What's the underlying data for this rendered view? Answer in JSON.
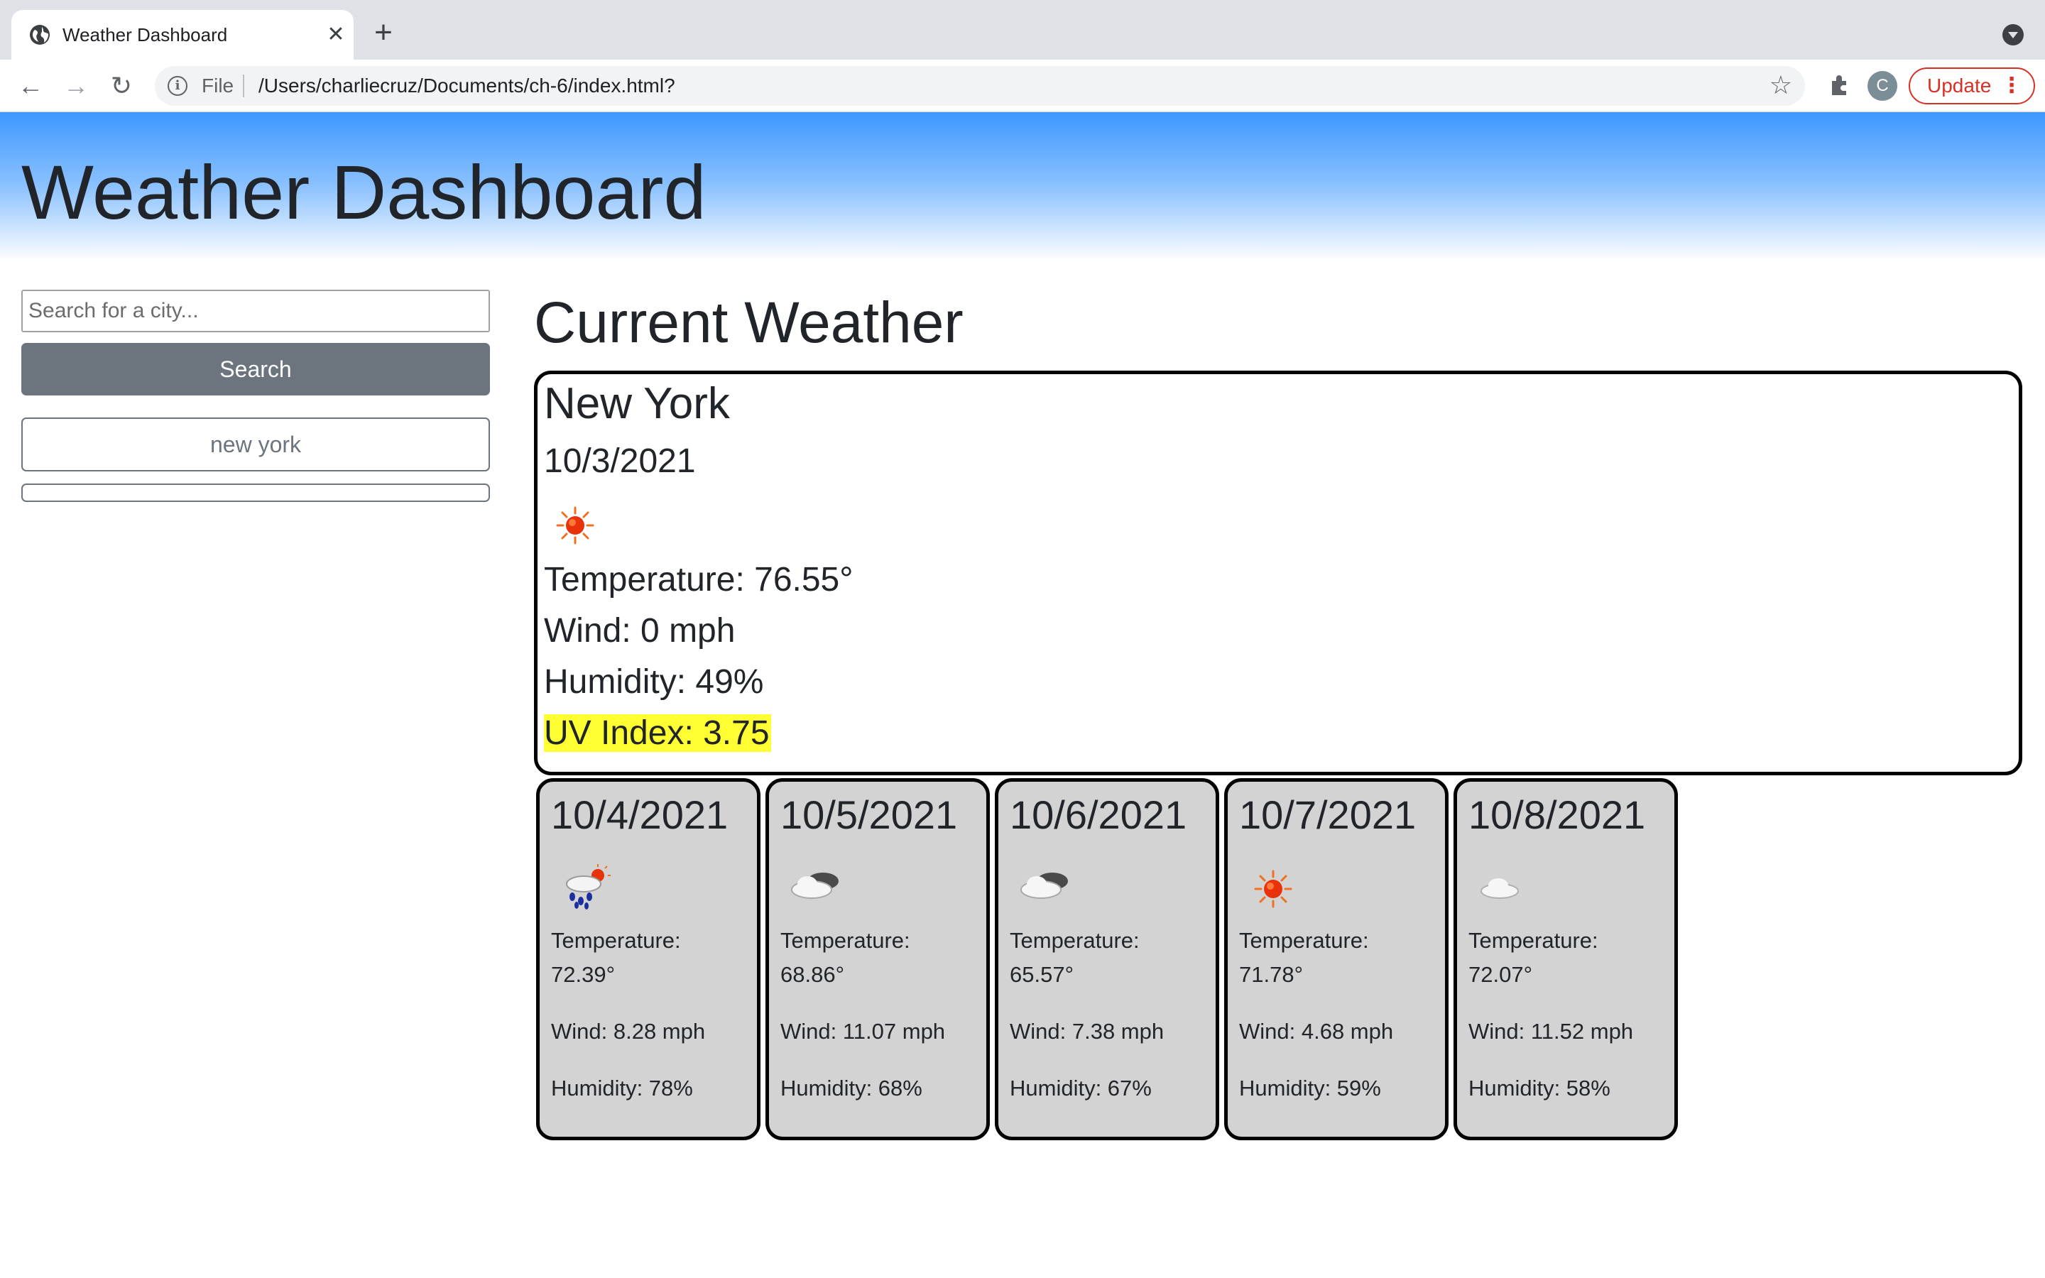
{
  "browser": {
    "tab_title": "Weather Dashboard",
    "new_tab": "+",
    "url_scheme": "File",
    "url": "/Users/charliecruz/Documents/ch-6/index.html?",
    "avatar_initial": "C",
    "update_label": "Update",
    "menu_dots": "⋮"
  },
  "header": {
    "title": "Weather Dashboard"
  },
  "sidebar": {
    "search_placeholder": "Search for a city...",
    "search_value": "",
    "search_button": "Search",
    "history": [
      "new york",
      ""
    ]
  },
  "current": {
    "section_title": "Current Weather",
    "city": "New York",
    "date": "10/3/2021",
    "icon": "sun-icon",
    "temperature": "Temperature: 76.55°",
    "wind": "Wind: 0 mph",
    "humidity": "Humidity: 49%",
    "uv": "UV Index: 3.75",
    "uv_color": "#ffff33"
  },
  "forecast": [
    {
      "date": "10/4/2021",
      "icon": "rain-sun-icon",
      "temp_label": "Temperature:",
      "temp_value": "72.39°",
      "wind": "Wind: 8.28 mph",
      "humidity": "Humidity: 78%"
    },
    {
      "date": "10/5/2021",
      "icon": "cloudy-icon",
      "temp_label": "Temperature:",
      "temp_value": "68.86°",
      "wind": "Wind: 11.07 mph",
      "humidity": "Humidity: 68%"
    },
    {
      "date": "10/6/2021",
      "icon": "cloudy-icon",
      "temp_label": "Temperature:",
      "temp_value": "65.57°",
      "wind": "Wind: 7.38 mph",
      "humidity": "Humidity: 67%"
    },
    {
      "date": "10/7/2021",
      "icon": "sun-icon",
      "temp_label": "Temperature:",
      "temp_value": "71.78°",
      "wind": "Wind: 4.68 mph",
      "humidity": "Humidity: 59%"
    },
    {
      "date": "10/8/2021",
      "icon": "cloud-icon",
      "temp_label": "Temperature:",
      "temp_value": "72.07°",
      "wind": "Wind: 11.52 mph",
      "humidity": "Humidity: 58%"
    }
  ],
  "colors": {
    "header_gradient_top": "#3d97ff",
    "search_button": "#6c757d",
    "forecast_card": "#d3d3d3",
    "update_accent": "#d93025"
  }
}
